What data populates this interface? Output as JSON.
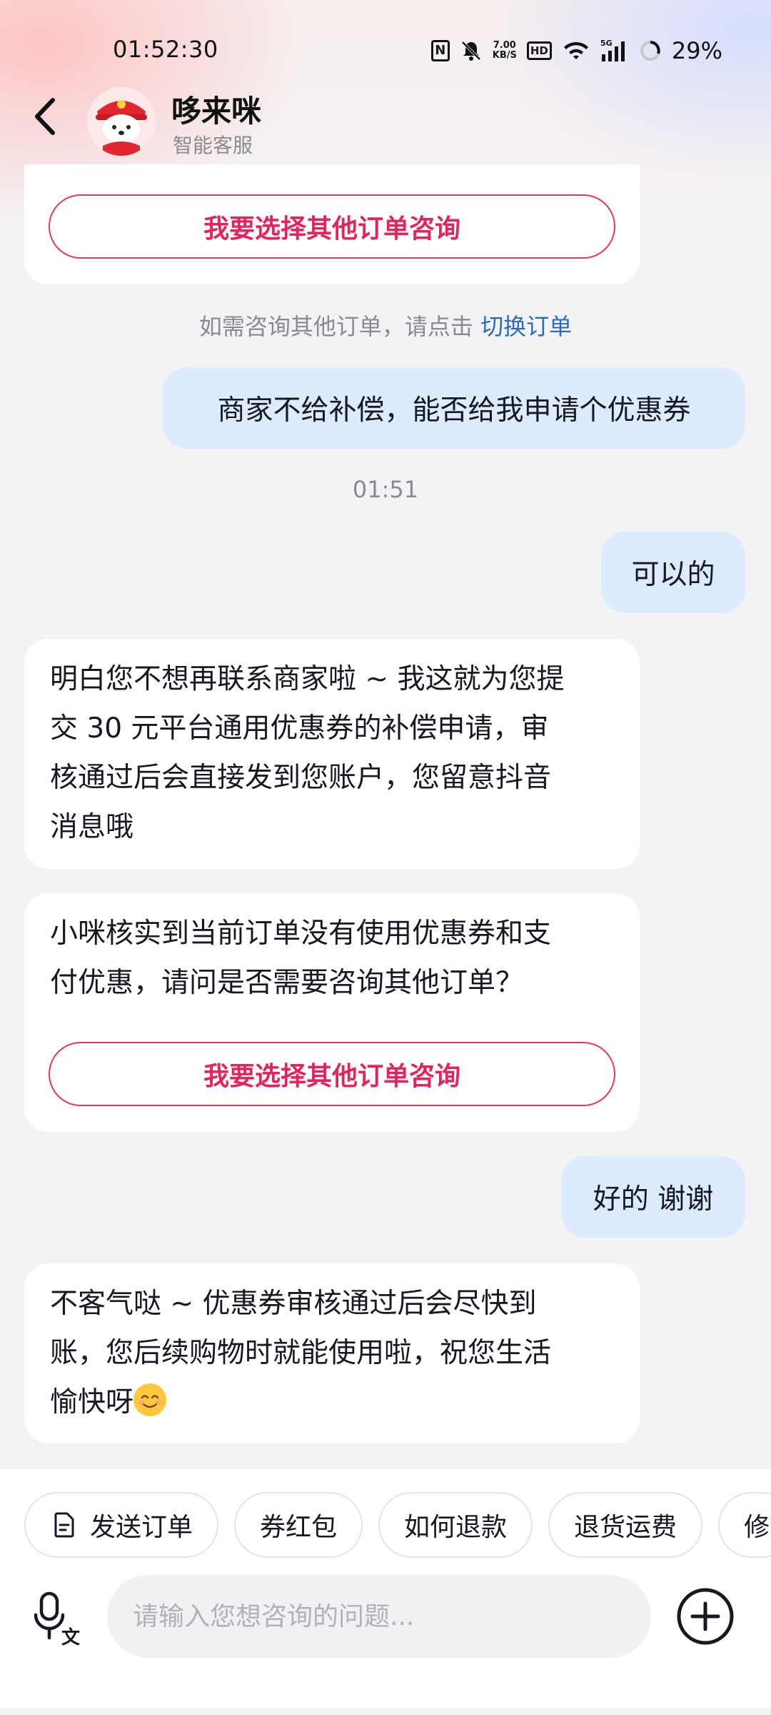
{
  "status_bar": {
    "time": "01:52:30",
    "speed_top": "7.00",
    "speed_bottom": "KB/S",
    "hd": "HD",
    "network": "5G",
    "battery": "29%"
  },
  "header": {
    "title": "哆来咪",
    "subtitle": "智能客服"
  },
  "messages": {
    "choose_other_order_btn_1": "我要选择其他订单咨询",
    "hint_text": "如需咨询其他订单，请点击",
    "hint_link": "切换订单",
    "user_msg_1": "商家不给补偿，能否给我申请个优惠券",
    "timestamp": "01:51",
    "user_msg_2": "可以的",
    "bot_msg_1_lines": [
      "明白您不想再联系商家啦 ~ 我这就为您提",
      "交 30 元平台通用优惠券的补偿申请，审",
      "核通过后会直接发到您账户，您留意抖音",
      "消息哦"
    ],
    "bot_msg_2_lines": [
      "小咪核实到当前订单没有使用优惠券和支",
      "付优惠，请问是否需要咨询其他订单？"
    ],
    "choose_other_order_btn_2": "我要选择其他订单咨询",
    "user_msg_3": "好的 谢谢",
    "bot_msg_3_lines": [
      "不客气哒 ~ 优惠券审核通过后会尽快到",
      "账，您后续购物时就能使用啦，祝您生活",
      "愉快呀"
    ]
  },
  "quick_chips": [
    "发送订单",
    "券红包",
    "如何退款",
    "退货运费",
    "修"
  ],
  "input": {
    "placeholder": "请输入您想咨询的问题..."
  },
  "colors": {
    "accent_red": "#e4245a",
    "link_blue": "#2a6cb6",
    "user_bubble": "#dcebfd"
  }
}
